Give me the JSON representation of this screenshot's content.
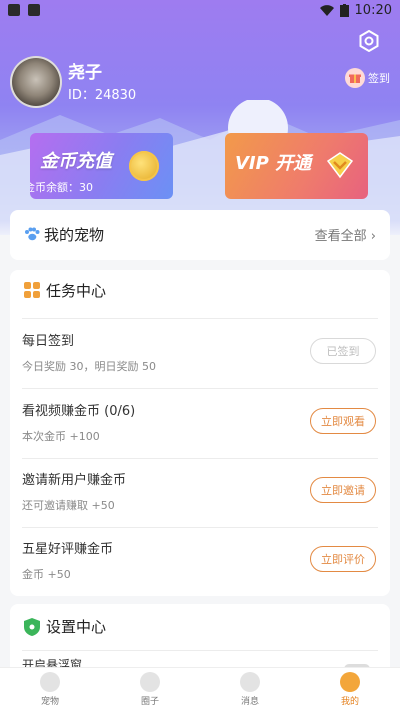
{
  "status_bar": {
    "time": "10:20"
  },
  "profile": {
    "username": "尧子",
    "user_id": "ID：24830",
    "checkin_label": "签到"
  },
  "cards": {
    "coin_title": "金币充值",
    "coin_balance": "金币余额：30",
    "vip_title": "VIP 开通"
  },
  "pets": {
    "title": "我的宠物",
    "view_all": "查看全部"
  },
  "tasks": {
    "title": "任务中心",
    "items": [
      {
        "title": "每日签到",
        "subtitle": "今日奖励 30，明日奖励 50",
        "button": "已签到",
        "done": true
      },
      {
        "title": "看视频赚金币 (0/6)",
        "subtitle": "本次金币 +100",
        "button": "立即观看",
        "done": false
      },
      {
        "title": "邀请新用户赚金币",
        "subtitle": "还可邀请赚取 +50",
        "button": "立即邀请",
        "done": false
      },
      {
        "title": "五星好评赚金币",
        "subtitle": "金币 +50",
        "button": "立即评价",
        "done": false
      }
    ]
  },
  "settings": {
    "title": "设置中心",
    "first_item": "开启悬浮窗"
  },
  "tabbar": {
    "tabs": [
      {
        "label": "宠物",
        "icon": "paw-icon"
      },
      {
        "label": "圈子",
        "icon": "circle-icon"
      },
      {
        "label": "消息",
        "icon": "message-icon"
      },
      {
        "label": "我的",
        "icon": "profile-icon"
      }
    ],
    "active_index": 3
  },
  "colors": {
    "accent": "#e38a43",
    "hero_top": "#9e7cf0",
    "vip_card": "#ef7b6c",
    "coin_card": "#8a7df1"
  }
}
